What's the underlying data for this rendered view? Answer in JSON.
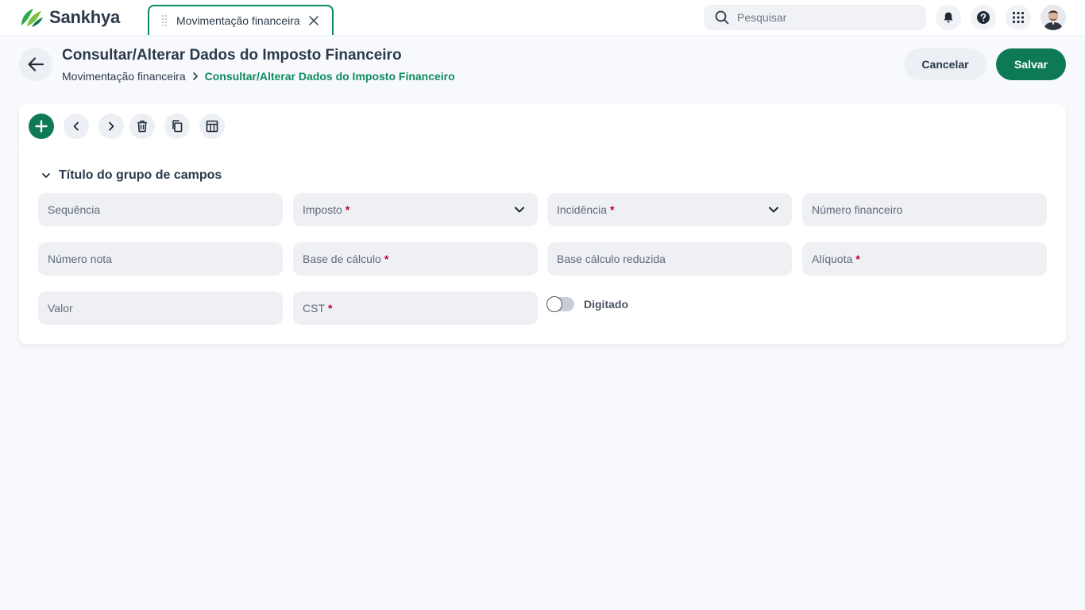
{
  "app": {
    "brand": "Sankhya"
  },
  "colors": {
    "accent": "#0e7a55",
    "required": "#c2002f",
    "background": "#f8f9fd"
  },
  "tab": {
    "label": "Movimentação financeira",
    "icon": "close-icon"
  },
  "search": {
    "placeholder": "Pesquisar"
  },
  "header_icons": [
    "bell-icon",
    "help-icon",
    "apps-grid-icon",
    "user-avatar"
  ],
  "page": {
    "title": "Consultar/Alterar Dados do Imposto Financeiro",
    "breadcrumb": {
      "parent": "Movimentação financeira",
      "current": "Consultar/Alterar Dados do Imposto Financeiro"
    }
  },
  "actions": {
    "cancel": "Cancelar",
    "save": "Salvar"
  },
  "toolbar": [
    "add-icon",
    "chevron-left-icon",
    "chevron-right-icon",
    "trash-icon",
    "copy-icon",
    "table-layout-icon"
  ],
  "form": {
    "group_title": "Título do grupo de campos",
    "fields": {
      "sequencia": {
        "label": "Sequência",
        "required": false
      },
      "imposto": {
        "label": "Imposto",
        "required": true,
        "type": "select"
      },
      "incidencia": {
        "label": "Incidência",
        "required": true,
        "type": "select"
      },
      "numero_financeiro": {
        "label": "Número financeiro",
        "required": false
      },
      "numero_nota": {
        "label": "Número nota",
        "required": false
      },
      "base_calculo": {
        "label": "Base de cálculo",
        "required": true
      },
      "base_calculo_reduzida": {
        "label": "Base cálculo reduzida",
        "required": false
      },
      "aliquota": {
        "label": "Alíquota",
        "required": true
      },
      "valor": {
        "label": "Valor",
        "required": false
      },
      "cst": {
        "label": "CST",
        "required": true
      }
    },
    "required_mark": "*",
    "toggle": {
      "label": "Digitado",
      "on": false
    }
  }
}
